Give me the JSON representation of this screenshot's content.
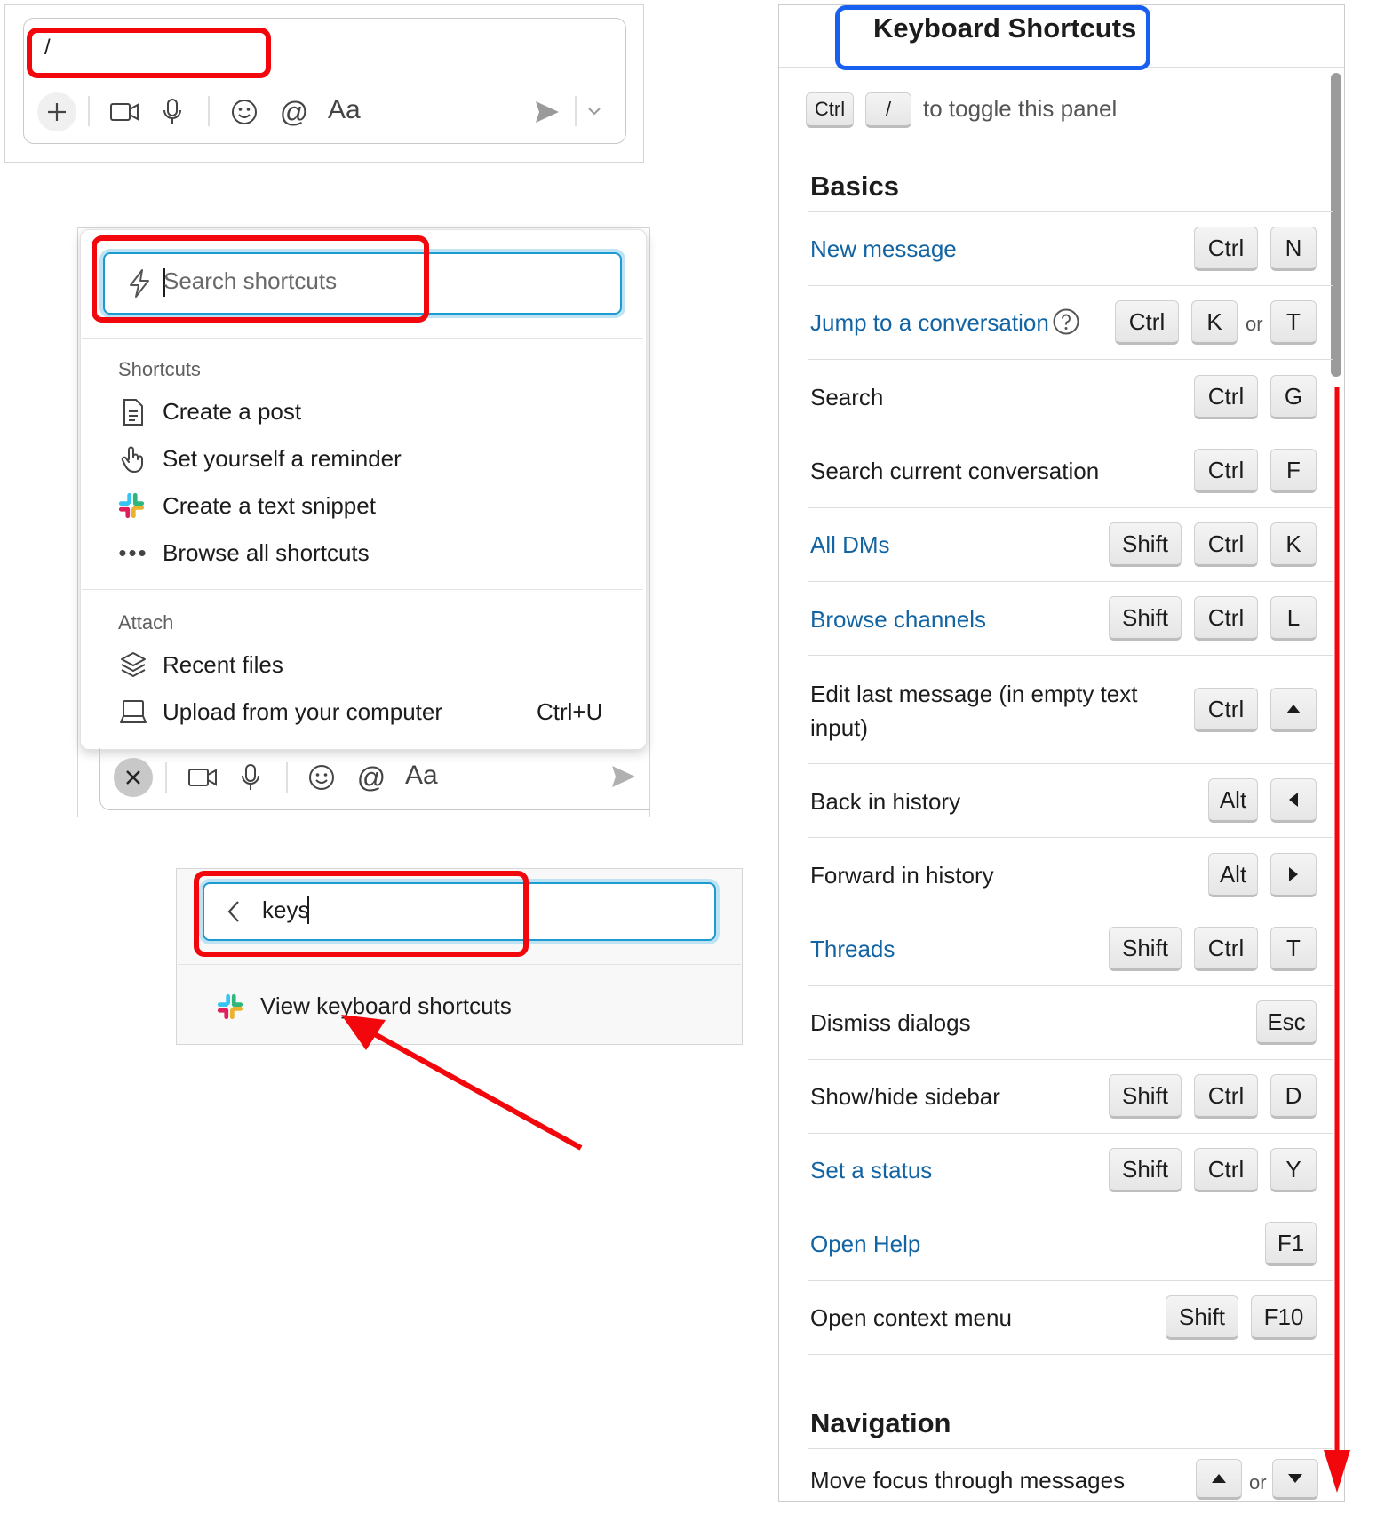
{
  "composer_top": {
    "input_value": "/",
    "toolbar": {
      "plus_icon": "plus-icon",
      "video_icon": "video-icon",
      "mic_icon": "microphone-icon",
      "emoji_icon": "emoji-icon",
      "mention_icon": "at-icon",
      "format_label": "Aa",
      "send_icon": "send-icon",
      "options_icon": "chevron-down-icon"
    }
  },
  "shortcuts_menu": {
    "search_placeholder": "Search shortcuts",
    "shortcuts_label": "Shortcuts",
    "shortcuts_items": [
      {
        "label": "Create a post",
        "icon": "document-icon"
      },
      {
        "label": "Set yourself a reminder",
        "icon": "hand-icon"
      },
      {
        "label": "Create a text snippet",
        "icon": "slack-logo-icon"
      },
      {
        "label": "Browse all shortcuts",
        "icon": "ellipsis-icon"
      }
    ],
    "attach_label": "Attach",
    "attach_items": [
      {
        "label": "Recent files",
        "icon": "layers-icon"
      },
      {
        "label": "Upload from your computer",
        "icon": "laptop-icon",
        "shortcut": "Ctrl+U"
      }
    ],
    "toolbar": {
      "close_icon": "close-icon",
      "format_label": "Aa"
    }
  },
  "search_keys": {
    "input_value": "keys",
    "result_label": "View keyboard shortcuts",
    "result_icon": "slack-logo-icon"
  },
  "keyboard_panel": {
    "title": "Keyboard Shortcuts",
    "toggle_keys": [
      "Ctrl",
      "/"
    ],
    "toggle_text": "to toggle this panel",
    "or_label": "or",
    "sections": [
      {
        "heading": "Basics",
        "rows": [
          {
            "label": "New message",
            "link": true,
            "keys": [
              "Ctrl",
              "N"
            ]
          },
          {
            "label": "Jump to a conversation",
            "link": true,
            "help": true,
            "keys": [
              "Ctrl",
              "K",
              "or",
              "T"
            ]
          },
          {
            "label": "Search",
            "link": false,
            "keys": [
              "Ctrl",
              "G"
            ]
          },
          {
            "label": "Search current conversation",
            "link": false,
            "keys": [
              "Ctrl",
              "F"
            ]
          },
          {
            "label": "All DMs",
            "link": true,
            "keys": [
              "Shift",
              "Ctrl",
              "K"
            ]
          },
          {
            "label": "Browse channels",
            "link": true,
            "keys": [
              "Shift",
              "Ctrl",
              "L"
            ]
          },
          {
            "label": "Edit last message (in empty text input)",
            "link": false,
            "keys": [
              "Ctrl",
              "up-arrow"
            ]
          },
          {
            "label": "Back in history",
            "link": false,
            "keys": [
              "Alt",
              "left-arrow"
            ]
          },
          {
            "label": "Forward in history",
            "link": false,
            "keys": [
              "Alt",
              "right-arrow"
            ]
          },
          {
            "label": "Threads",
            "link": true,
            "keys": [
              "Shift",
              "Ctrl",
              "T"
            ]
          },
          {
            "label": "Dismiss dialogs",
            "link": false,
            "keys": [
              "Esc"
            ]
          },
          {
            "label": "Show/hide sidebar",
            "link": false,
            "keys": [
              "Shift",
              "Ctrl",
              "D"
            ]
          },
          {
            "label": "Set a status",
            "link": true,
            "keys": [
              "Shift",
              "Ctrl",
              "Y"
            ]
          },
          {
            "label": "Open Help",
            "link": true,
            "keys": [
              "F1"
            ]
          },
          {
            "label": "Open context menu",
            "link": false,
            "keys": [
              "Shift",
              "F10"
            ]
          }
        ]
      },
      {
        "heading": "Navigation",
        "rows": [
          {
            "label": "Move focus through messages",
            "link": false,
            "keys": [
              "up-arrow",
              "or",
              "down-arrow"
            ]
          }
        ]
      }
    ]
  },
  "colors": {
    "highlight_red": "#f2070c",
    "highlight_blue": "#1861f0",
    "link_blue": "#1264a3",
    "focus_ring": "#1d9bd1"
  }
}
